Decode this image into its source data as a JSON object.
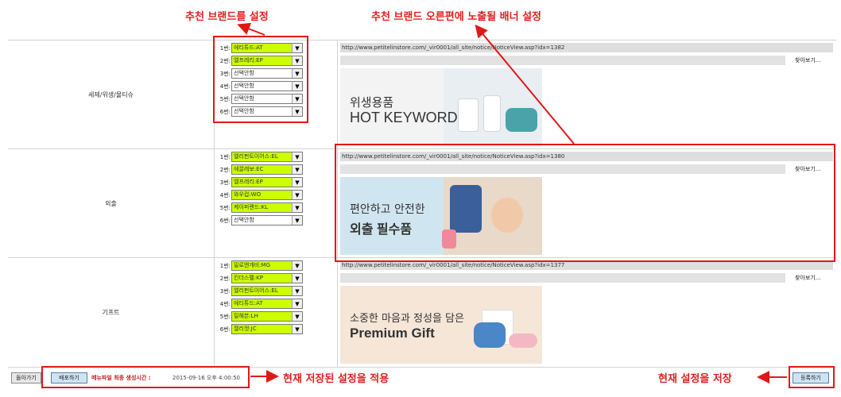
{
  "annotations": {
    "brand_setting": "추천 브랜드를 설정",
    "banner_setting": "추천 브랜드 오른편에 노출될 배너 설정",
    "apply_current": "현재 저장된 설정을 적용",
    "save_current": "현재 설정을 저장"
  },
  "rows": [
    {
      "category": "세제/위생/물티슈",
      "slots": [
        {
          "num": "1번:",
          "value": "에티튜드:AT",
          "highlight": true
        },
        {
          "num": "2번:",
          "value": "엘프레리:EP",
          "highlight": true
        },
        {
          "num": "3번:",
          "value": "선택안함",
          "highlight": false
        },
        {
          "num": "4번:",
          "value": "선택안함",
          "highlight": false
        },
        {
          "num": "5번:",
          "value": "선택안함",
          "highlight": false
        },
        {
          "num": "6번:",
          "value": "선택안함",
          "highlight": false
        }
      ],
      "url": "http://www.petitelinstore.com/_vir0001/all_site/notice/NoticeView.asp?idx=1382",
      "find_label": "찾아보기...",
      "banner": {
        "line1": "위생용품",
        "line2": "HOT KEYWORD"
      }
    },
    {
      "category": "외출",
      "slots": [
        {
          "num": "1번:",
          "value": "엘리펀트이어스:EL",
          "highlight": true
        },
        {
          "num": "2번:",
          "value": "에끌레보:EC",
          "highlight": true
        },
        {
          "num": "3번:",
          "value": "엘프레리:EP",
          "highlight": true
        },
        {
          "num": "4번:",
          "value": "와우컵:WO",
          "highlight": true
        },
        {
          "num": "5번:",
          "value": "케이퍼랜드:KL",
          "highlight": true
        },
        {
          "num": "6번:",
          "value": "선택안함",
          "highlight": false
        }
      ],
      "url": "http://www.petitelinstore.com/_vir0001/all_site/notice/NoticeView.asp?idx=1380",
      "find_label": "찾아보기...",
      "banner": {
        "line1": "편안하고 안전한",
        "line2": "외출 필수품"
      }
    },
    {
      "category": "기프트",
      "slots": [
        {
          "num": "1번:",
          "value": "밀로앤개비:MG",
          "highlight": true
        },
        {
          "num": "2번:",
          "value": "킨더스펠:KP",
          "highlight": true
        },
        {
          "num": "3번:",
          "value": "엘리펀트이어스:EL",
          "highlight": true
        },
        {
          "num": "4번:",
          "value": "에티튜드:AT",
          "highlight": true
        },
        {
          "num": "5번:",
          "value": "릴헤븐:LH",
          "highlight": true
        },
        {
          "num": "6번:",
          "value": "젤리캣:JC",
          "highlight": true
        }
      ],
      "url": "http://www.petitelinstore.com/_vir0001/all_site/notice/NoticeView.asp?idx=1377",
      "find_label": "찾아보기...",
      "banner": {
        "line1": "소중한 마음과 정성을 담은",
        "line2": "Premium Gift"
      }
    }
  ],
  "footer": {
    "back_label": "돌아가기",
    "deploy_label": "배포하기",
    "menu_file_label": "메뉴파일 최종 생성시간 :",
    "menu_file_time": "2015-09-16 오후 4:00:50",
    "register_label": "등록하기"
  },
  "colors": {
    "annotation": "#e02020",
    "highlight": "#ccff00"
  }
}
